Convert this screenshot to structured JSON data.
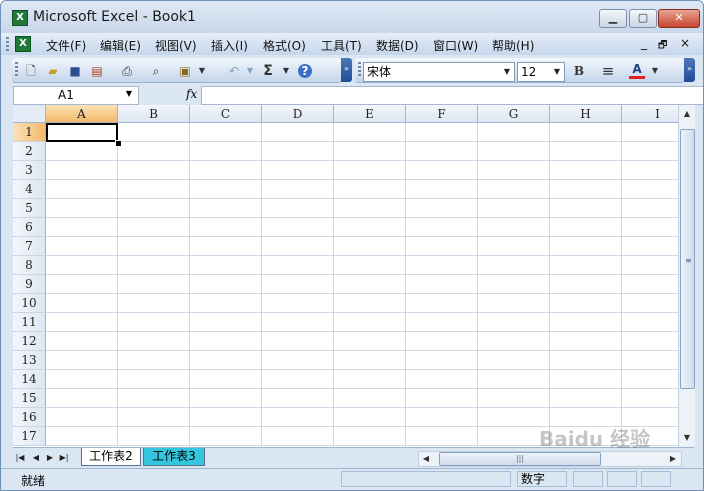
{
  "window": {
    "title": "Microsoft Excel - Book1",
    "app_icon": "excel-icon",
    "buttons": {
      "minimize": "▁",
      "maximize": "▢",
      "close": "✕"
    }
  },
  "menubar": {
    "items": [
      {
        "label": "文件(F)"
      },
      {
        "label": "编辑(E)"
      },
      {
        "label": "视图(V)"
      },
      {
        "label": "插入(I)"
      },
      {
        "label": "格式(O)"
      },
      {
        "label": "工具(T)"
      },
      {
        "label": "数据(D)"
      },
      {
        "label": "窗口(W)"
      },
      {
        "label": "帮助(H)"
      }
    ],
    "mdi": {
      "minimize": "_",
      "restore": "🗗",
      "close": "×"
    }
  },
  "toolbar": {
    "standard_icons": [
      "new-icon",
      "open-icon",
      "save-icon",
      "permission-icon",
      "print-icon",
      "research-icon",
      "paste-icon",
      "undo-icon",
      "autosum-icon",
      "help-icon"
    ],
    "autosum_symbol": "Σ",
    "help_symbol": "?",
    "font": "宋体",
    "font_size": "12",
    "bold": "B",
    "align": "≡",
    "font_color_letter": "A",
    "font_color": "#e02020"
  },
  "formula_bar": {
    "name_box": "A1",
    "fx": "fx",
    "formula": ""
  },
  "sheet": {
    "columns": [
      "A",
      "B",
      "C",
      "D",
      "E",
      "F",
      "G",
      "H",
      "I"
    ],
    "rows": [
      "1",
      "2",
      "3",
      "4",
      "5",
      "6",
      "7",
      "8",
      "9",
      "10",
      "11",
      "12",
      "13",
      "14",
      "15",
      "16",
      "17"
    ],
    "selected_column": "A",
    "selected_row": "1"
  },
  "tabs": {
    "sheets": [
      "工作表2",
      "工作表3"
    ],
    "active_sheet": "工作表2"
  },
  "status": {
    "left": "就绪",
    "mode": "数字"
  },
  "watermark": "Baidu 经验"
}
